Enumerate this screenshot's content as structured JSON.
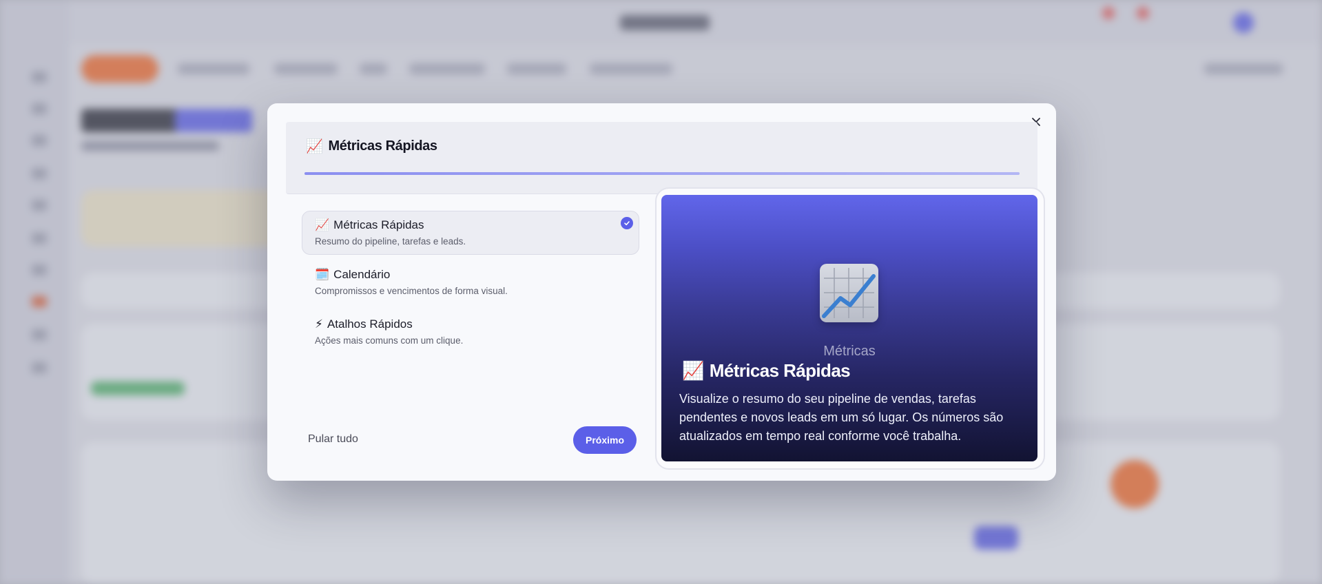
{
  "modal": {
    "header_emoji": "📈",
    "header_title": "Métricas Rápidas",
    "progress_fraction": 1.0,
    "steps": [
      {
        "emoji": "📈",
        "title": "Métricas Rápidas",
        "description": "Resumo do pipeline, tarefas e leads.",
        "active": true,
        "completed": true
      },
      {
        "emoji": "🗓️",
        "title": "Calendário",
        "description": "Compromissos e vencimentos de forma visual.",
        "active": false,
        "completed": false
      },
      {
        "emoji": "⚡",
        "title": "Atalhos Rápidos",
        "description": "Ações mais comuns com um clique.",
        "active": false,
        "completed": false
      }
    ],
    "skip_label": "Pular tudo",
    "next_label": "Próximo",
    "preview": {
      "caption": "Métricas",
      "emoji": "📈",
      "title": "Métricas Rápidas",
      "body": "Visualize o resumo do seu pipeline de vendas, tarefas pendentes e novos leads em um só lugar. Os números são atualizados em tempo real conforme você trabalha."
    }
  },
  "colors": {
    "accent": "#5b5fe8",
    "brand_orange": "#ef6b2f",
    "preview_gradient_top": "#6166ea",
    "preview_gradient_bottom": "#121332"
  },
  "icons": {
    "close": "close-icon",
    "check": "check-icon",
    "chart": "chart-increasing-icon",
    "calendar": "calendar-icon",
    "lightning": "lightning-icon"
  }
}
